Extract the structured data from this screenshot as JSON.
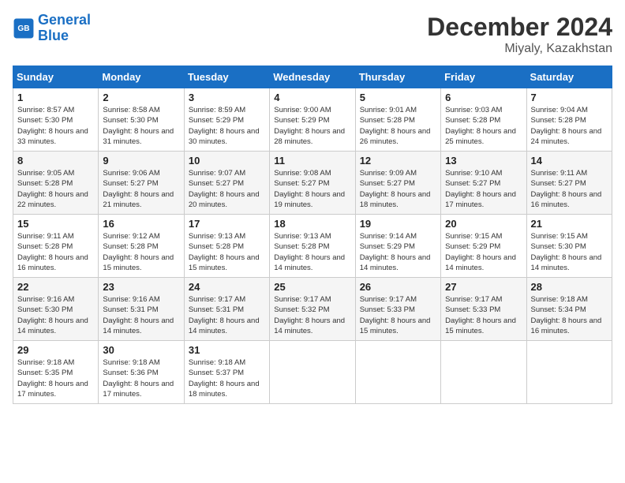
{
  "header": {
    "logo_line1": "General",
    "logo_line2": "Blue",
    "month": "December 2024",
    "location": "Miyaly, Kazakhstan"
  },
  "columns": [
    "Sunday",
    "Monday",
    "Tuesday",
    "Wednesday",
    "Thursday",
    "Friday",
    "Saturday"
  ],
  "weeks": [
    [
      {
        "day": "1",
        "sunrise": "8:57 AM",
        "sunset": "5:30 PM",
        "daylight": "8 hours and 33 minutes."
      },
      {
        "day": "2",
        "sunrise": "8:58 AM",
        "sunset": "5:30 PM",
        "daylight": "8 hours and 31 minutes."
      },
      {
        "day": "3",
        "sunrise": "8:59 AM",
        "sunset": "5:29 PM",
        "daylight": "8 hours and 30 minutes."
      },
      {
        "day": "4",
        "sunrise": "9:00 AM",
        "sunset": "5:29 PM",
        "daylight": "8 hours and 28 minutes."
      },
      {
        "day": "5",
        "sunrise": "9:01 AM",
        "sunset": "5:28 PM",
        "daylight": "8 hours and 26 minutes."
      },
      {
        "day": "6",
        "sunrise": "9:03 AM",
        "sunset": "5:28 PM",
        "daylight": "8 hours and 25 minutes."
      },
      {
        "day": "7",
        "sunrise": "9:04 AM",
        "sunset": "5:28 PM",
        "daylight": "8 hours and 24 minutes."
      }
    ],
    [
      {
        "day": "8",
        "sunrise": "9:05 AM",
        "sunset": "5:28 PM",
        "daylight": "8 hours and 22 minutes."
      },
      {
        "day": "9",
        "sunrise": "9:06 AM",
        "sunset": "5:27 PM",
        "daylight": "8 hours and 21 minutes."
      },
      {
        "day": "10",
        "sunrise": "9:07 AM",
        "sunset": "5:27 PM",
        "daylight": "8 hours and 20 minutes."
      },
      {
        "day": "11",
        "sunrise": "9:08 AM",
        "sunset": "5:27 PM",
        "daylight": "8 hours and 19 minutes."
      },
      {
        "day": "12",
        "sunrise": "9:09 AM",
        "sunset": "5:27 PM",
        "daylight": "8 hours and 18 minutes."
      },
      {
        "day": "13",
        "sunrise": "9:10 AM",
        "sunset": "5:27 PM",
        "daylight": "8 hours and 17 minutes."
      },
      {
        "day": "14",
        "sunrise": "9:11 AM",
        "sunset": "5:27 PM",
        "daylight": "8 hours and 16 minutes."
      }
    ],
    [
      {
        "day": "15",
        "sunrise": "9:11 AM",
        "sunset": "5:28 PM",
        "daylight": "8 hours and 16 minutes."
      },
      {
        "day": "16",
        "sunrise": "9:12 AM",
        "sunset": "5:28 PM",
        "daylight": "8 hours and 15 minutes."
      },
      {
        "day": "17",
        "sunrise": "9:13 AM",
        "sunset": "5:28 PM",
        "daylight": "8 hours and 15 minutes."
      },
      {
        "day": "18",
        "sunrise": "9:13 AM",
        "sunset": "5:28 PM",
        "daylight": "8 hours and 14 minutes."
      },
      {
        "day": "19",
        "sunrise": "9:14 AM",
        "sunset": "5:29 PM",
        "daylight": "8 hours and 14 minutes."
      },
      {
        "day": "20",
        "sunrise": "9:15 AM",
        "sunset": "5:29 PM",
        "daylight": "8 hours and 14 minutes."
      },
      {
        "day": "21",
        "sunrise": "9:15 AM",
        "sunset": "5:30 PM",
        "daylight": "8 hours and 14 minutes."
      }
    ],
    [
      {
        "day": "22",
        "sunrise": "9:16 AM",
        "sunset": "5:30 PM",
        "daylight": "8 hours and 14 minutes."
      },
      {
        "day": "23",
        "sunrise": "9:16 AM",
        "sunset": "5:31 PM",
        "daylight": "8 hours and 14 minutes."
      },
      {
        "day": "24",
        "sunrise": "9:17 AM",
        "sunset": "5:31 PM",
        "daylight": "8 hours and 14 minutes."
      },
      {
        "day": "25",
        "sunrise": "9:17 AM",
        "sunset": "5:32 PM",
        "daylight": "8 hours and 14 minutes."
      },
      {
        "day": "26",
        "sunrise": "9:17 AM",
        "sunset": "5:33 PM",
        "daylight": "8 hours and 15 minutes."
      },
      {
        "day": "27",
        "sunrise": "9:17 AM",
        "sunset": "5:33 PM",
        "daylight": "8 hours and 15 minutes."
      },
      {
        "day": "28",
        "sunrise": "9:18 AM",
        "sunset": "5:34 PM",
        "daylight": "8 hours and 16 minutes."
      }
    ],
    [
      {
        "day": "29",
        "sunrise": "9:18 AM",
        "sunset": "5:35 PM",
        "daylight": "8 hours and 17 minutes."
      },
      {
        "day": "30",
        "sunrise": "9:18 AM",
        "sunset": "5:36 PM",
        "daylight": "8 hours and 17 minutes."
      },
      {
        "day": "31",
        "sunrise": "9:18 AM",
        "sunset": "5:37 PM",
        "daylight": "8 hours and 18 minutes."
      },
      null,
      null,
      null,
      null
    ]
  ]
}
